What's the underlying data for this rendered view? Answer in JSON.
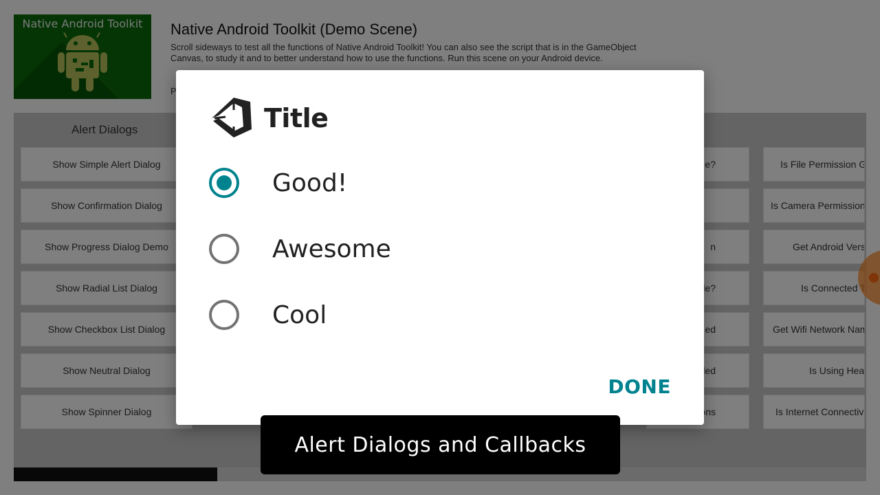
{
  "header": {
    "logo_text": "Native Android Toolkit",
    "title": "Native Android Toolkit (Demo Scene)",
    "description": "Scroll sideways to test all the functions of Native Android Toolkit! You can also see the script that is in the GameObject Canvas, to study it and to better understand how to use the functions. Run this scene on your Android device.",
    "partial_text": "P"
  },
  "panel": {
    "column_title": "Alert Dialogs",
    "left_buttons": [
      "Show Simple Alert Dialog",
      "Show Confirmation Dialog",
      "Show Progress Dialog Demo",
      "Show Radial List Dialog",
      "Show Checkbox List Dialog",
      "Show Neutral Dialog",
      "Show Spinner Dialog"
    ],
    "middle_buttons": [
      "e?",
      "",
      "n",
      "le?",
      "ed",
      "led",
      "ons"
    ],
    "right_buttons": [
      "Is File Permission G",
      "Is Camera Permission",
      "Get Android Vers",
      "Is Connected T",
      "Get Wifi Network Nam",
      "Is Using Hea",
      "Is Internet Connectiv"
    ]
  },
  "dialog": {
    "title": "Title",
    "options": [
      {
        "label": "Good!",
        "selected": true
      },
      {
        "label": "Awesome",
        "selected": false
      },
      {
        "label": "Cool",
        "selected": false
      }
    ],
    "done_label": "DONE",
    "accent_color": "#00838f"
  },
  "caption": {
    "text": "Alert Dialogs and Callbacks"
  }
}
